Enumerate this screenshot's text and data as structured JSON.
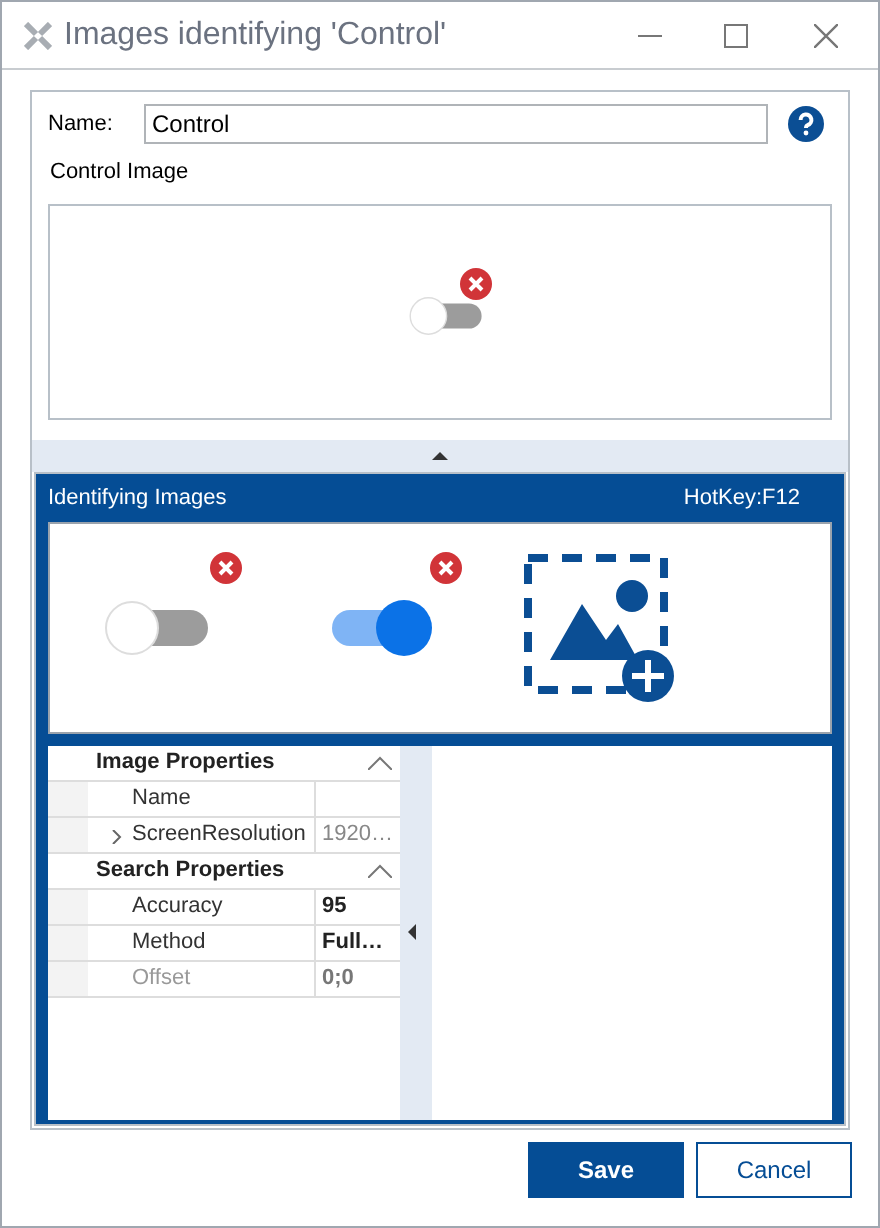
{
  "window": {
    "title": "Images identifying 'Control'"
  },
  "name_field": {
    "label": "Name:",
    "value": "Control"
  },
  "control_image": {
    "label": "Control Image",
    "kind": "toggle-off"
  },
  "identifying_images": {
    "title": "Identifying Images",
    "hotkey": "HotKey:F12",
    "images": [
      {
        "kind": "toggle-off"
      },
      {
        "kind": "toggle-on"
      },
      {
        "kind": "add"
      }
    ]
  },
  "properties": [
    {
      "title": "Image Properties",
      "expanded": true,
      "rows": [
        {
          "label": "Name",
          "readonly": false
        },
        {
          "label": "ScreenResolution",
          "value": "1920…",
          "readonly": true,
          "expanded": false
        }
      ]
    },
    {
      "title": "Search Properties",
      "expanded": true,
      "rows": [
        {
          "label": "Accuracy",
          "value": "95",
          "readonly": false
        },
        {
          "label": "Method",
          "value": "Full…",
          "readonly": false
        },
        {
          "label": "Offset",
          "value": "0;0",
          "readonly": true
        }
      ]
    }
  ],
  "buttons": [
    {
      "label": "Save",
      "kind": "primary"
    },
    {
      "label": "Cancel",
      "kind": "secondary"
    }
  ]
}
